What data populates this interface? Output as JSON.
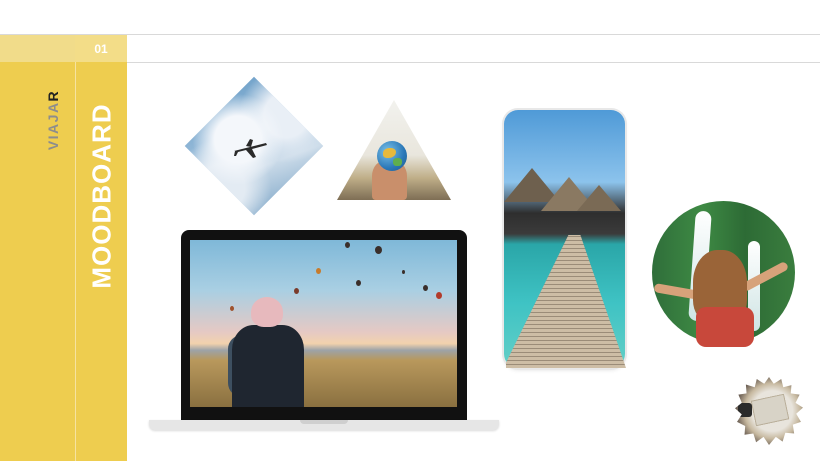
{
  "slide": {
    "number": "01",
    "brand": {
      "prefix": "VIAJA",
      "suffix": "R"
    },
    "title": "MOODBOARD"
  },
  "images": {
    "diamond": "airplane-sky-photo",
    "triangle": "hand-holding-globe-photo",
    "laptop": "hot-air-balloons-traveler-photo",
    "phone": "overwater-bungalows-pier-photo",
    "circle": "waterfall-backpacker-photo",
    "badge": "travel-map-flatlay-photo"
  },
  "colors": {
    "accent": "#eecd4f",
    "accent_light": "#f1dc8a",
    "brand_gray": "#8d8d8d",
    "brand_dark": "#222222"
  }
}
